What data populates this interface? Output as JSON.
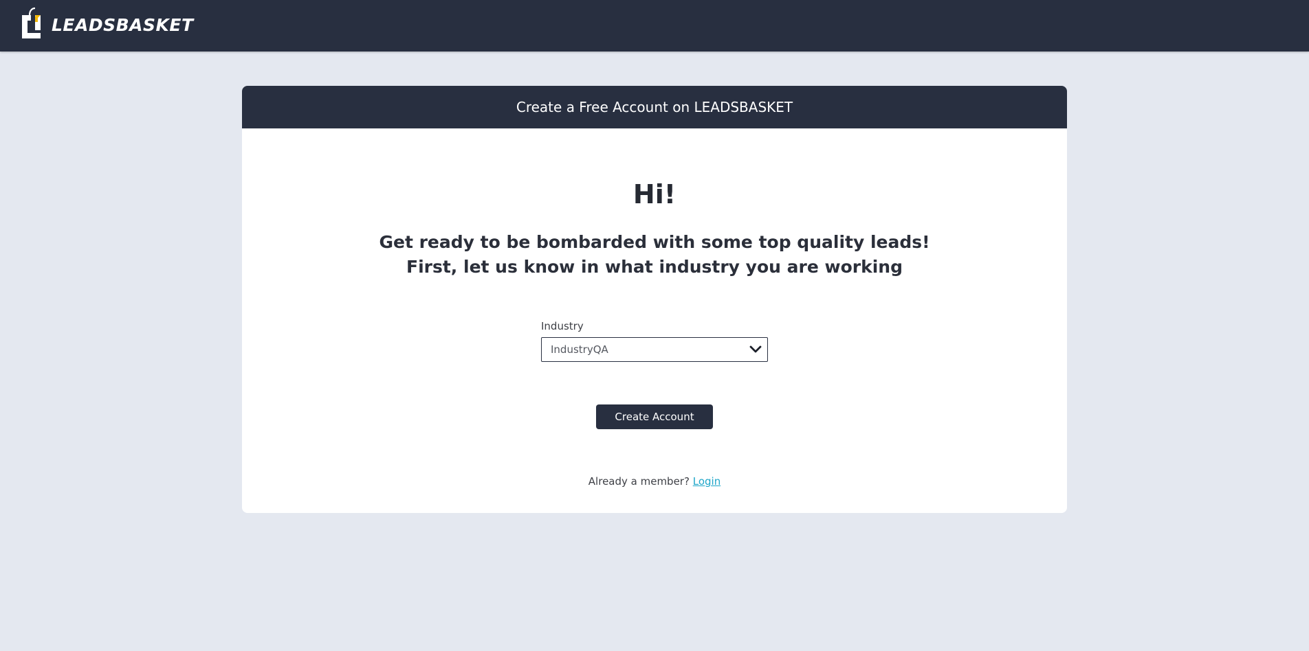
{
  "header": {
    "brand": "LEADSBASKET",
    "logo_icon": "basket-logo-icon",
    "accent_color": "#f2b705"
  },
  "card": {
    "title": "Create a Free Account on LEADSBASKET",
    "greeting": "Hi!",
    "subtitle_line1": "Get ready to be bombarded with some top quality leads!",
    "subtitle_line2": "First, let us know in what industry you are working"
  },
  "form": {
    "industry_label": "Industry",
    "industry_value": "IndustryQA",
    "dropdown_icon": "chevron-down-icon",
    "submit_label": "Create Account"
  },
  "footer": {
    "member_text": "Already a member?",
    "login_link": "Login"
  },
  "colors": {
    "navy": "#282f40",
    "background": "#e4e8f0",
    "link": "#1fa6c9"
  }
}
